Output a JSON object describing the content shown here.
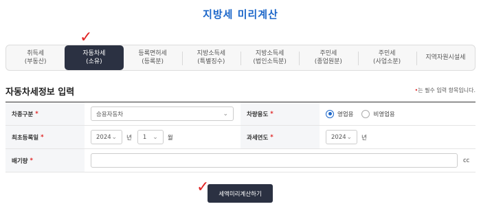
{
  "page": {
    "title": "지방세 미리계산"
  },
  "tabs": [
    {
      "line1": "취득세",
      "line2": "(부동산)",
      "active": false
    },
    {
      "line1": "자동차세",
      "line2": "(소유)",
      "active": true
    },
    {
      "line1": "등록면허세",
      "line2": "(등록분)",
      "active": false
    },
    {
      "line1": "지방소득세",
      "line2": "(특별징수)",
      "active": false
    },
    {
      "line1": "지방소득세",
      "line2": "(법인소득분)",
      "active": false
    },
    {
      "line1": "주민세",
      "line2": "(종업원분)",
      "active": false
    },
    {
      "line1": "주민세",
      "line2": "(사업소분)",
      "active": false
    },
    {
      "line1": "지역자원시설세",
      "line2": "",
      "active": false
    }
  ],
  "section": {
    "title": "자동차세정보 입력",
    "required_mark": "•",
    "required_note": "는 필수 입력 항목입니다."
  },
  "form": {
    "vehicle_type": {
      "label": "차종구분",
      "value": "승용자동차"
    },
    "vehicle_use": {
      "label": "차량용도",
      "options": [
        "영업용",
        "비영업용"
      ],
      "selected": "영업용"
    },
    "first_registration": {
      "label": "최초등록일",
      "year": "2024",
      "year_unit": "년",
      "month": "1",
      "month_unit": "월"
    },
    "tax_year": {
      "label": "과세연도",
      "year": "2024",
      "year_unit": "년"
    },
    "displacement": {
      "label": "배기량",
      "value": "",
      "unit": "cc"
    }
  },
  "required_star": "*",
  "submit": {
    "label": "세액미리계산하기"
  },
  "annotations": {
    "check_mark": "✓"
  },
  "colors": {
    "accent": "#1b66c9",
    "active_tab": "#2b3142",
    "required": "#e02424"
  }
}
